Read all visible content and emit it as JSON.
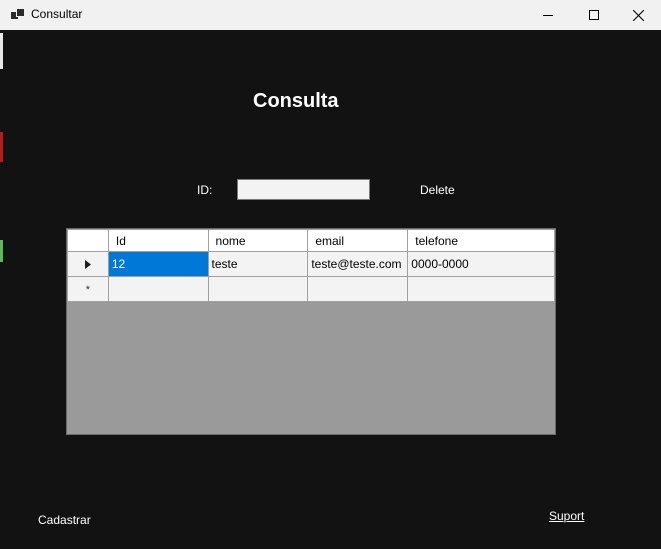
{
  "window": {
    "title": "Consultar"
  },
  "form": {
    "heading": "Consulta",
    "id_label": "ID:",
    "id_value": "",
    "delete_label": "Delete",
    "cadastrar_label": "Cadastrar",
    "suport_label": "Suport"
  },
  "grid": {
    "columns": [
      "Id",
      "nome",
      "email",
      "telefone"
    ],
    "rows": [
      {
        "id": "12",
        "nome": "teste",
        "email": "teste@teste.com",
        "telefone": "0000-0000",
        "selected_cell": "id"
      }
    ],
    "new_row_marker": "*"
  },
  "colors": {
    "background": "#121212",
    "titlebar": "#f1f1f1",
    "grid_background": "#9a9a9a",
    "selection": "#0078d7"
  }
}
